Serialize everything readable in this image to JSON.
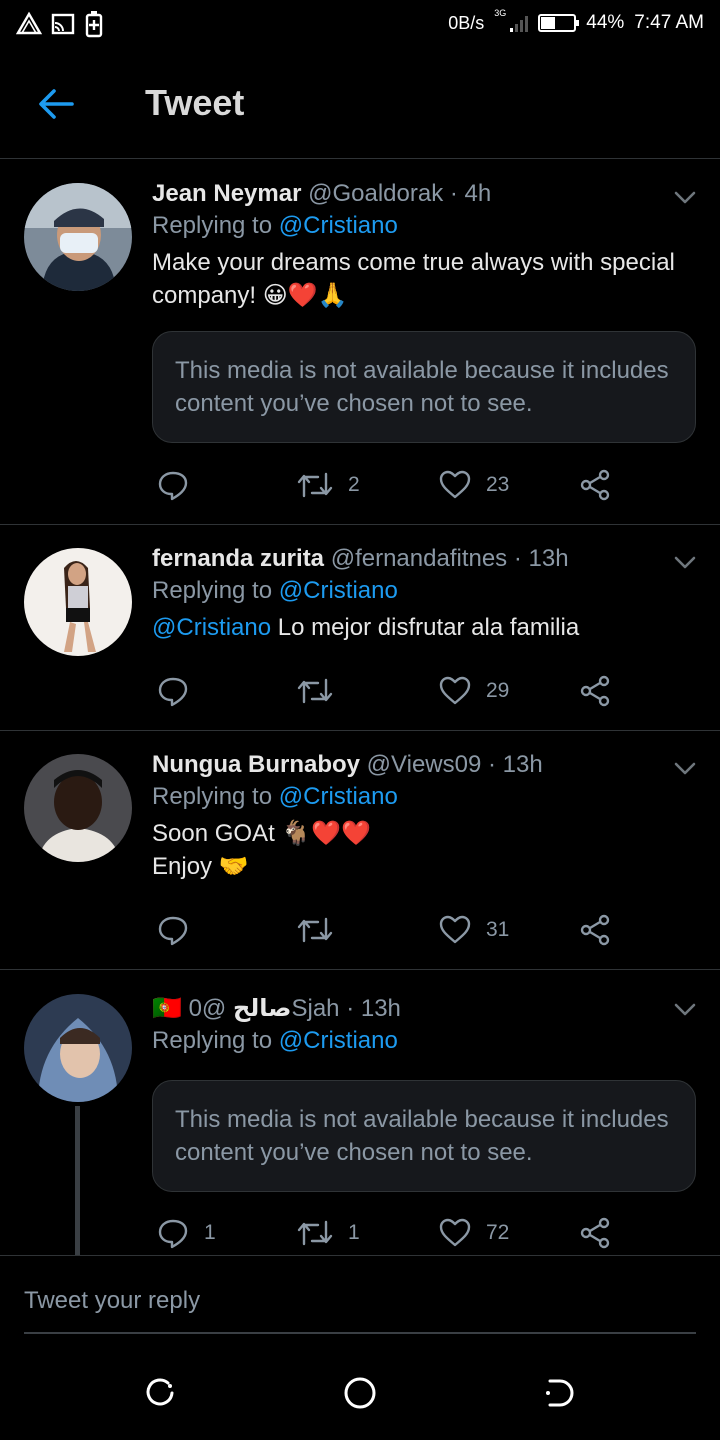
{
  "status_bar": {
    "net_speed": "0B/s",
    "network_type": "3G",
    "battery": "44%",
    "battery_level": 0.44,
    "time": "7:47 AM"
  },
  "header": {
    "title": "Tweet",
    "back_icon": "arrow-left-icon",
    "accent": "#1d9bf0"
  },
  "tweets": [
    {
      "name": "Jean Neymar",
      "meta": "@Goaldorak · 4h",
      "replying_prefix": "Replying to ",
      "replying_to": "@Cristiano",
      "text": "Make your dreams come true always with special company! 😀❤️🙏",
      "media_notice": "This media is not available because it includes content you’ve chosen not to see.",
      "reply_count": "",
      "retweet_count": "2",
      "like_count": "23"
    },
    {
      "name": "fernanda zurita",
      "meta": "@fernandafitnes · 13h",
      "replying_prefix": "Replying to ",
      "replying_to": "@Cristiano",
      "text_mention": "@Cristiano",
      "text": " Lo mejor disfrutar ala familia",
      "reply_count": "",
      "retweet_count": "",
      "like_count": "29"
    },
    {
      "name": "Nungua Burnaboy",
      "meta": "@Views09 · 13h",
      "replying_prefix": "Replying to ",
      "replying_to": "@Cristiano",
      "text_line1": "Soon GOAt 🐐❤️❤️",
      "text_line2": "Enjoy 🤝",
      "reply_count": "",
      "retweet_count": "",
      "like_count": "31"
    },
    {
      "name": "صالح",
      "flag": "🇵🇹",
      "meta": "@0Sjah · 13h",
      "replying_prefix": "Replying to ",
      "replying_to": "@Cristiano",
      "media_notice": "This media is not available because it includes content you’ve chosen not to see.",
      "reply_count": "1",
      "retweet_count": "1",
      "like_count": "72"
    }
  ],
  "reply_bar": {
    "placeholder": "Tweet your reply"
  },
  "nav": {
    "recent": "recent-apps-icon",
    "home": "home-circle-icon",
    "back": "back-nav-icon"
  }
}
